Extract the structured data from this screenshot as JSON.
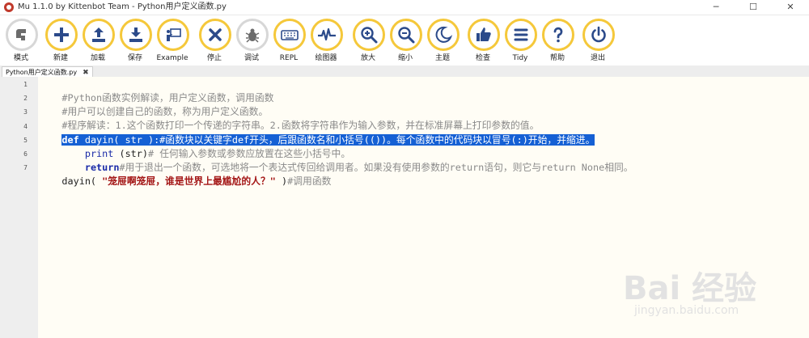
{
  "window": {
    "title": "Mu 1.1.0 by Kittenbot Team - Python用户定义函数.py",
    "controls": [
      "─",
      "☐",
      "✕"
    ]
  },
  "toolbar": [
    {
      "id": "mode",
      "label": "模式",
      "icon": "mode-icon"
    },
    {
      "id": "new",
      "label": "新建",
      "icon": "plus-icon"
    },
    {
      "id": "load",
      "label": "加载",
      "icon": "upload-icon"
    },
    {
      "id": "save",
      "label": "保存",
      "icon": "download-icon"
    },
    {
      "id": "example",
      "label": "Example",
      "icon": "teacher-icon"
    },
    {
      "id": "stop",
      "label": "停止",
      "icon": "close-icon"
    },
    {
      "id": "debug",
      "label": "调试",
      "icon": "bug-icon"
    },
    {
      "id": "repl",
      "label": "REPL",
      "icon": "keyboard-icon"
    },
    {
      "id": "plotter",
      "label": "绘图器",
      "icon": "waveform-icon"
    },
    {
      "id": "zoom_in",
      "label": "放大",
      "icon": "zoom-in-icon"
    },
    {
      "id": "zoom_out",
      "label": "缩小",
      "icon": "zoom-out-icon"
    },
    {
      "id": "theme",
      "label": "主题",
      "icon": "moon-icon"
    },
    {
      "id": "check",
      "label": "检查",
      "icon": "thumbs-up-icon"
    },
    {
      "id": "tidy",
      "label": "Tidy",
      "icon": "lines-icon"
    },
    {
      "id": "help",
      "label": "帮助",
      "icon": "question-icon"
    },
    {
      "id": "quit",
      "label": "退出",
      "icon": "power-icon"
    }
  ],
  "tab": {
    "label": "Python用户定义函数.py",
    "close": "✖"
  },
  "editor": {
    "line_numbers": [
      "1",
      "2",
      "3",
      "4",
      "5",
      "6",
      "7"
    ],
    "lines": {
      "l1": "#Python函数实例解读，用户定义函数，调用函数",
      "l2": "#用户可以创建自己的函数，称为用户定义函数。",
      "l3": "#程序解读：1.这个函数打印一个传递的字符串。2.函数将字符串作为输入参数，并在标准屏幕上打印参数的值。",
      "l4_kw": "def",
      "l4_code": " dayin( str ):",
      "l4_comment": "#函数块以关键字def开头，后跟函数名和小括号(())。每个函数中的代码块以冒号(:)开始，并缩进。",
      "l5_indent": "    ",
      "l5_fn": "print",
      "l5_code": " (str)",
      "l5_comment": "# 任何输入参数或参数应放置在这些小括号中。",
      "l6_indent": "    ",
      "l6_kw": "return",
      "l6_comment": "#用于退出一个函数，可选地将一个表达式传回给调用者。如果没有使用参数的return语句，则它与return None相同。",
      "l7_code": "dayin( ",
      "l7_str": "\"笼屉啊笼屉，谁是世界上最尴尬的人？\"",
      "l7_code2": " )",
      "l7_comment": "#调用函数"
    }
  },
  "watermark": {
    "text": "Bai 经验",
    "sub": "jingyan.baidu.com"
  },
  "colors": {
    "accent": "#f5c83a",
    "selection": "#1560d4",
    "keyword": "#1a2aa8",
    "string": "#a31515",
    "comment": "#8a8a8a"
  }
}
